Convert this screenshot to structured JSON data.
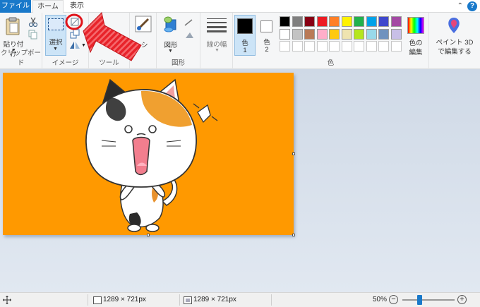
{
  "tabs": {
    "file": "ファイル",
    "home": "ホーム",
    "view": "表示"
  },
  "ribbon": {
    "clipboard": {
      "paste": "貼り付け",
      "label": "クリップボード"
    },
    "image": {
      "select": "選択",
      "label": "イメージ"
    },
    "tools": {
      "label": "ツール"
    },
    "brush": {
      "partial_label": "シ"
    },
    "shapes": {
      "shapes": "図形",
      "label": "図形"
    },
    "size": {
      "label": "線の幅"
    },
    "colors": {
      "color1_top": "色",
      "color1_num": "1",
      "color2_top": "色",
      "color2_num": "2",
      "label": "色",
      "edit_top": "色の",
      "edit_bottom": "編集",
      "paint3d_top": "ペイント 3D",
      "paint3d_bottom": "で編集する",
      "row1": [
        "#000000",
        "#7f7f7f",
        "#880015",
        "#ed1c24",
        "#ff7f27",
        "#fff200",
        "#22b14c",
        "#00a2e8",
        "#3f48cc",
        "#a349a4"
      ],
      "row2": [
        "#ffffff",
        "#c3c3c3",
        "#b97a57",
        "#ffaec9",
        "#ffc90e",
        "#efe4b0",
        "#b5e61d",
        "#99d9ea",
        "#7092be",
        "#c8bfe7"
      ]
    }
  },
  "status": {
    "selection_size": "1289 × 721px",
    "image_size": "1289 × 721px",
    "zoom": "50%",
    "zoom_level": 0.5
  },
  "colors": {
    "accent": "#1979ca",
    "canvas_bg": "#ff9900",
    "annotation_red": "#e8232a"
  }
}
